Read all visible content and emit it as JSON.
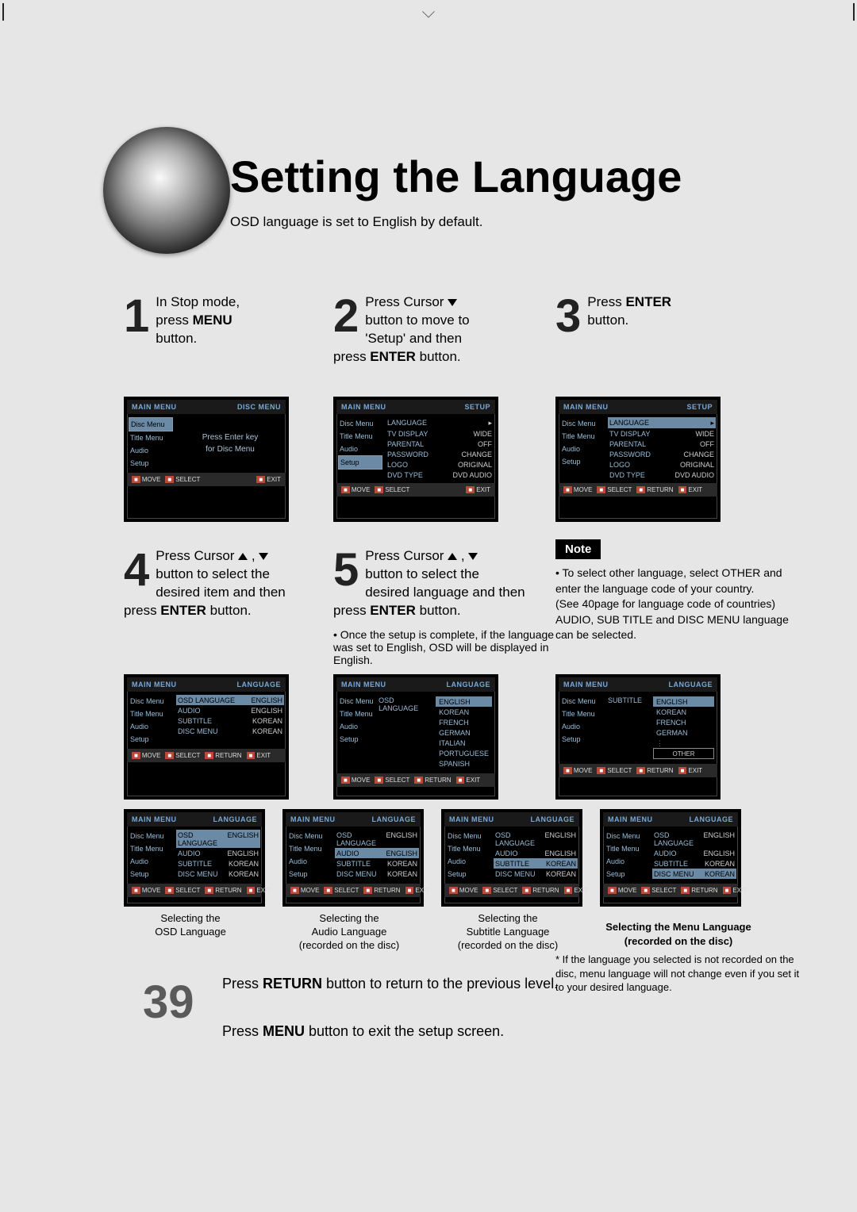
{
  "header": {
    "title": "Setting the Language",
    "subtitle": "OSD language is set to English by default."
  },
  "steps": {
    "s1": {
      "num": "1",
      "line1": "In Stop mode,",
      "line2a": "press ",
      "line2b": "MENU",
      "line3": "button."
    },
    "s2": {
      "num": "2",
      "line1": "Press Cursor ",
      "line2": "button to move to",
      "line3": "'Setup' and then",
      "line4a": "press ",
      "line4b": "ENTER",
      "line4c": " button."
    },
    "s3": {
      "num": "3",
      "line1a": "Press ",
      "line1b": "ENTER",
      "line2": "button."
    },
    "s4": {
      "num": "4",
      "line1": "Press Cursor ",
      "line2": "button to select the",
      "line3": "desired item and then",
      "line4a": "press ",
      "line4b": "ENTER",
      "line4c": " button."
    },
    "s5": {
      "num": "5",
      "line1": "Press Cursor ",
      "line2": "button to select the",
      "line3": "desired language and then",
      "line4a": "press ",
      "line4b": "ENTER",
      "line4c": " button.",
      "note": "• Once the setup is complete, if the language was set to English, OSD will be displayed in English."
    }
  },
  "noteBox": {
    "label": "Note",
    "bullet1": "• To select other language, select OTHER and enter the language code of your country.",
    "bullet2": "(See 40page for language code of countries)",
    "bullet3": "AUDIO, SUB TITLE and DISC MENU language can be selected."
  },
  "panels": {
    "sidebar": {
      "disc": "Disc Menu",
      "title": "Title Menu",
      "audio": "Audio",
      "setup": "Setup"
    },
    "p1": {
      "hdrL": "MAIN MENU",
      "hdrR": "DISC MENU",
      "msg1": "Press Enter key",
      "msg2": "for Disc Menu"
    },
    "setupRows": {
      "language": "LANGUAGE",
      "tvdisplay": "TV DISPLAY",
      "tvdisplay_v": "WIDE",
      "parental": "PARENTAL",
      "parental_v": "OFF",
      "password": "PASSWORD",
      "password_v": "CHANGE",
      "logo": "LOGO",
      "logo_v": "ORIGINAL",
      "dvdtype": "DVD TYPE",
      "dvdtype_v": "DVD AUDIO"
    },
    "p2": {
      "hdrL": "MAIN MENU",
      "hdrR": "SETUP"
    },
    "p3": {
      "hdrL": "MAIN MENU",
      "hdrR": "SETUP"
    },
    "langHdr": {
      "l": "MAIN MENU",
      "r": "LANGUAGE"
    },
    "langRows": {
      "osd": "OSD LANGUAGE",
      "osd_v": "ENGLISH",
      "audio": "AUDIO",
      "audio_v": "ENGLISH",
      "subtitle": "SUBTITLE",
      "subtitle_v": "KOREAN",
      "discmenu": "DISC MENU",
      "discmenu_v": "KOREAN"
    },
    "p5list": {
      "label": "OSD LANGUAGE",
      "opts": [
        "ENGLISH",
        "KOREAN",
        "FRENCH",
        "GERMAN",
        "ITALIAN",
        "PORTUGUESE",
        "SPANISH"
      ]
    },
    "p6list": {
      "label": "SUBTITLE",
      "opts": [
        "ENGLISH",
        "KOREAN",
        "FRENCH",
        "GERMAN"
      ],
      "other": "OTHER"
    },
    "ftr": {
      "move": "MOVE",
      "select": "SELECT",
      "ret": "RETURN",
      "exit": "EXIT"
    }
  },
  "captions": {
    "c1": "Selecting the\nOSD Language",
    "c2": "Selecting the\nAudio Language\n(recorded on the disc)",
    "c3": "Selecting the\nSubtitle Language\n(recorded on the disc)",
    "c4_title": "Selecting the Menu Language\n(recorded on the disc)",
    "c4_body": "* If the language you selected is not recorded on the disc, menu language will not change even if you set it to your desired language."
  },
  "bottom": {
    "pageNum": "39",
    "line1a": "Press ",
    "line1b": "RETURN",
    "line1c": " button to return to the previous level.",
    "line2a": "Press ",
    "line2b": "MENU",
    "line2c": " button to exit the setup screen."
  }
}
